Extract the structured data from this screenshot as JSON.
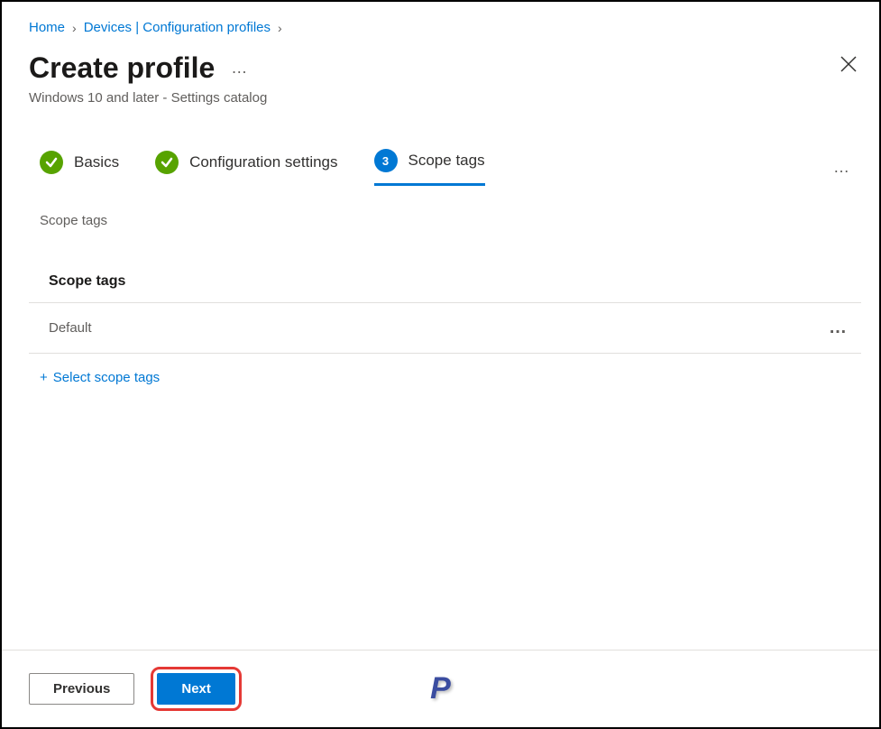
{
  "breadcrumb": {
    "home": "Home",
    "devices": "Devices | Configuration profiles"
  },
  "header": {
    "title": "Create profile",
    "subtitle": "Windows 10 and later - Settings catalog"
  },
  "wizard": {
    "step1": "Basics",
    "step2": "Configuration settings",
    "step3_number": "3",
    "step3": "Scope tags"
  },
  "section": {
    "label": "Scope tags",
    "table_header": "Scope tags",
    "row_value": "Default",
    "select_link": "Select scope tags"
  },
  "footer": {
    "previous": "Previous",
    "next": "Next"
  },
  "logo_text": "P"
}
